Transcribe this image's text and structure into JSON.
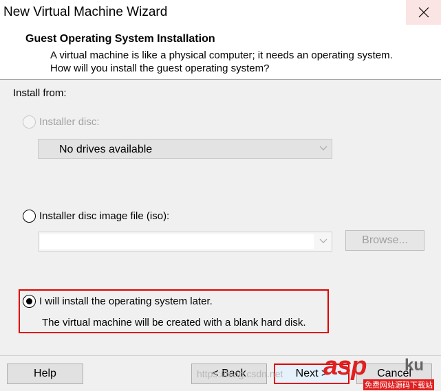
{
  "window": {
    "title": "New Virtual Machine Wizard"
  },
  "header": {
    "title": "Guest Operating System Installation",
    "description": "A virtual machine is like a physical computer; it needs an operating system. How will you install the guest operating system?"
  },
  "install_from_label": "Install from:",
  "options": {
    "disc": {
      "label": "Installer disc:",
      "enabled": false,
      "selected": false,
      "dropdown_value": "No drives available"
    },
    "iso": {
      "label": "Installer disc image file (iso):",
      "enabled": true,
      "selected": false,
      "path_value": "",
      "browse_label": "Browse...",
      "browse_enabled": false
    },
    "later": {
      "label": "I will install the operating system later.",
      "selected": true,
      "note": "The virtual machine will be created with a blank hard disk."
    }
  },
  "buttons": {
    "help": "Help",
    "back": "< Back",
    "next": "Next >",
    "cancel": "Cancel"
  },
  "watermark": {
    "brand": "asp",
    "domain": "ku",
    "sub": "免费网站源码下载站",
    "url": "https://blog.csdn.net"
  },
  "colors": {
    "highlight_box": "#e00000",
    "close_hover": "#f8d7d7"
  }
}
